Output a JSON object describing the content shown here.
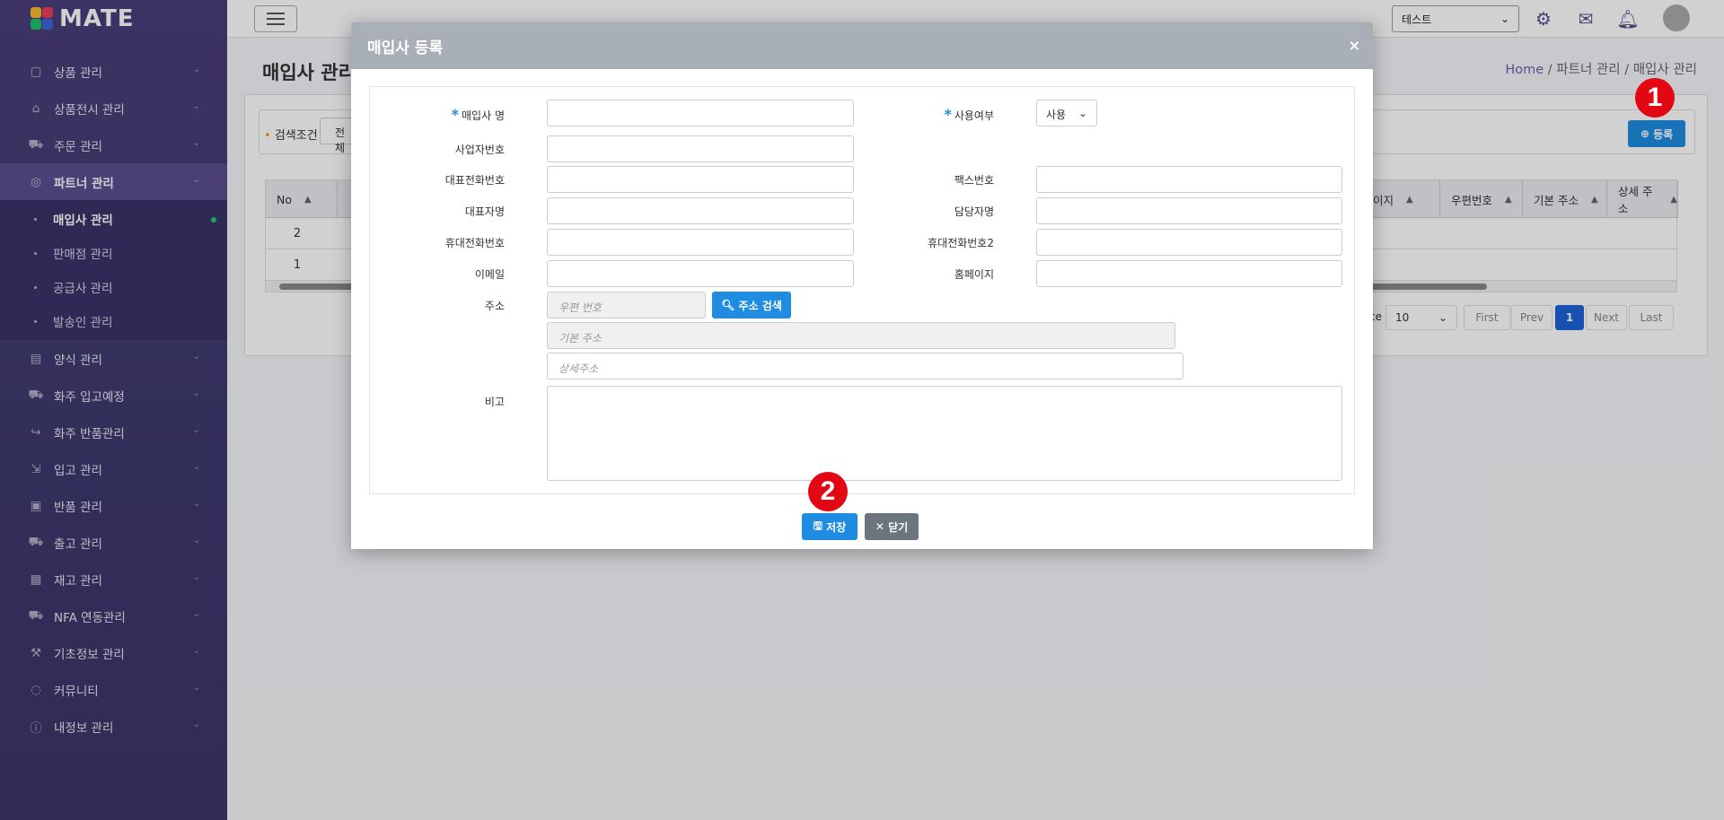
{
  "app": {
    "logo": "MATE"
  },
  "sidebar": {
    "items": [
      {
        "label": "상품 관리",
        "icon": "box-icon"
      },
      {
        "label": "상품전시 관리",
        "icon": "store-icon"
      },
      {
        "label": "주문 관리",
        "icon": "cart-icon"
      },
      {
        "label": "파트너 관리",
        "icon": "handshake-icon"
      },
      {
        "label": "양식 관리",
        "icon": "document-icon"
      },
      {
        "label": "화주 입고예정",
        "icon": "truck-icon"
      },
      {
        "label": "화주 반품관리",
        "icon": "return-icon"
      },
      {
        "label": "입고 관리",
        "icon": "inbound-icon"
      },
      {
        "label": "반품 관리",
        "icon": "return-box-icon"
      },
      {
        "label": "출고 관리",
        "icon": "outbound-icon"
      },
      {
        "label": "재고 관리",
        "icon": "inventory-icon"
      },
      {
        "label": "NFA 연동관리",
        "icon": "link-icon"
      },
      {
        "label": "기초정보 관리",
        "icon": "wrench-icon"
      },
      {
        "label": "커뮤니티",
        "icon": "chat-icon"
      },
      {
        "label": "내정보 관리",
        "icon": "info-icon"
      }
    ],
    "submenu": [
      {
        "label": "매입사 관리"
      },
      {
        "label": "판매점 관리"
      },
      {
        "label": "공급사 관리"
      },
      {
        "label": "발송인 관리"
      }
    ]
  },
  "topbar": {
    "select_value": "테스트"
  },
  "page": {
    "title": "매입사 관리",
    "breadcrumb": {
      "home": "Home",
      "sep": "/",
      "level1": "파트너 관리",
      "level2": "매입사 관리"
    },
    "search_label": "검색조건",
    "search_select": "전체",
    "register_button": "등록"
  },
  "grid": {
    "columns": [
      {
        "label": "No"
      },
      {
        "label": "이지"
      },
      {
        "label": "우편번호"
      },
      {
        "label": "기본 주소"
      },
      {
        "label": "상세 주소"
      }
    ],
    "rows": [
      {
        "no": "2"
      },
      {
        "no": "1"
      }
    ],
    "pager": {
      "page_size_label": "ce",
      "page_size": "10",
      "first": "First",
      "prev": "Prev",
      "current": "1",
      "next": "Next",
      "last": "Last"
    }
  },
  "modal": {
    "title": "매입사 등록",
    "close": "×",
    "fields": {
      "name_label": "매입사 명",
      "use_label": "사용여부",
      "use_value": "사용",
      "biz_label": "사업자번호",
      "tel_label": "대표전화번호",
      "fax_label": "팩스번호",
      "ceo_label": "대표자명",
      "manager_label": "담당자명",
      "mobile_label": "휴대전화번호",
      "mobile2_label": "휴대전화번호2",
      "email_label": "이메일",
      "homepage_label": "홈페이지",
      "address_label": "주소",
      "zip_placeholder": "우편 번호",
      "address_search_button": "주소 검색",
      "base_address_placeholder": "기본 주소",
      "detail_address_placeholder": "상세주소",
      "note_label": "비고"
    },
    "save_button": "저장",
    "close_button": "닫기"
  },
  "annotations": {
    "mark1": "1",
    "mark2": "2",
    "color": "#e30613"
  }
}
